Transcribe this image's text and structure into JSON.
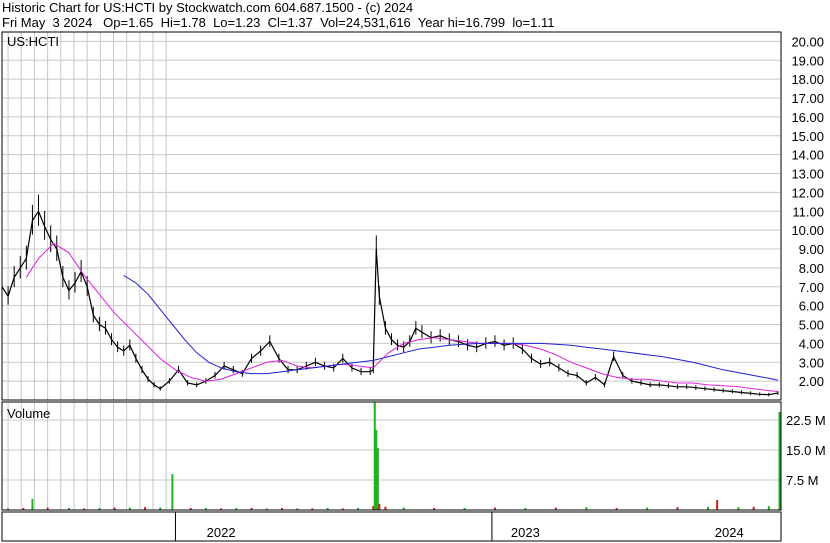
{
  "header": {
    "line1": "Historic Chart for US:HCTI by Stockwatch.com 604.687.1500 - (c) 2024",
    "date": "Fri May  3 2024",
    "op": "Op=1.65",
    "hi": "Hi=1.78",
    "lo": "Lo=1.23",
    "cl": "Cl=1.37",
    "vol": "Vol=24,531,616",
    "year_hi": "Year hi=16.799",
    "year_lo": "lo=1.11"
  },
  "colors": {
    "grid": "#c8c8c8",
    "price": "#000000",
    "ma_short": "#e020e0",
    "ma_long": "#2020d0",
    "volume_up": "#20b020",
    "volume_down": "#d02020",
    "frame": "#000000"
  },
  "chart_data": [
    {
      "type": "line",
      "title": "US:HCTI",
      "y_axis_side": "right",
      "ylim": [
        1.0,
        20.5
      ],
      "y_ticks": [
        "2.00",
        "3.00",
        "4.00",
        "5.00",
        "6.00",
        "7.00",
        "8.00",
        "9.00",
        "10.00",
        "11.00",
        "12.00",
        "13.00",
        "14.00",
        "15.00",
        "16.00",
        "17.00",
        "18.00",
        "19.00",
        "20.00"
      ],
      "x_range": [
        2021.78,
        2024.34
      ],
      "x_labels": [
        "2022",
        "2023",
        "2024"
      ],
      "series": [
        {
          "role": "price",
          "x": [
            2021.78,
            2021.8,
            2021.82,
            2021.84,
            2021.86,
            2021.88,
            2021.9,
            2021.92,
            2021.94,
            2021.96,
            2021.98,
            2022.0,
            2022.02,
            2022.04,
            2022.06,
            2022.08,
            2022.1,
            2022.12,
            2022.14,
            2022.16,
            2022.18,
            2022.2,
            2022.22,
            2022.24,
            2022.26,
            2022.28,
            2022.3,
            2022.33,
            2022.36,
            2022.39,
            2022.42,
            2022.45,
            2022.48,
            2022.51,
            2022.54,
            2022.57,
            2022.6,
            2022.63,
            2022.66,
            2022.69,
            2022.72,
            2022.75,
            2022.78,
            2022.81,
            2022.84,
            2022.87,
            2022.9,
            2022.93,
            2022.96,
            2022.99,
            2023.0,
            2023.01,
            2023.02,
            2023.04,
            2023.06,
            2023.08,
            2023.1,
            2023.12,
            2023.14,
            2023.16,
            2023.19,
            2023.22,
            2023.25,
            2023.28,
            2023.31,
            2023.34,
            2023.37,
            2023.4,
            2023.43,
            2023.46,
            2023.49,
            2023.52,
            2023.55,
            2023.58,
            2023.61,
            2023.64,
            2023.67,
            2023.7,
            2023.73,
            2023.76,
            2023.79,
            2023.82,
            2023.85,
            2023.88,
            2023.91,
            2023.94,
            2023.97,
            2024.0,
            2024.03,
            2024.06,
            2024.09,
            2024.12,
            2024.15,
            2024.18,
            2024.21,
            2024.24,
            2024.27,
            2024.3,
            2024.33
          ],
          "values": [
            7.0,
            6.5,
            7.5,
            8.0,
            8.5,
            10.5,
            11.0,
            10.2,
            9.5,
            9.0,
            7.5,
            6.8,
            7.2,
            7.8,
            7.0,
            5.5,
            5.0,
            4.8,
            4.2,
            3.8,
            3.6,
            3.9,
            3.2,
            2.6,
            2.1,
            1.8,
            1.6,
            2.0,
            2.6,
            1.9,
            1.8,
            2.0,
            2.3,
            2.8,
            2.6,
            2.4,
            3.2,
            3.6,
            4.1,
            3.2,
            2.6,
            2.6,
            2.8,
            3.0,
            2.8,
            2.7,
            3.2,
            2.7,
            2.5,
            2.5,
            2.6,
            9.0,
            6.5,
            4.8,
            4.2,
            3.9,
            3.8,
            4.1,
            4.8,
            4.6,
            4.3,
            4.4,
            4.2,
            4.1,
            3.9,
            3.8,
            4.0,
            4.1,
            3.9,
            4.0,
            3.7,
            3.2,
            2.9,
            3.0,
            2.7,
            2.4,
            2.3,
            1.9,
            2.2,
            1.8,
            3.3,
            2.3,
            2.0,
            1.9,
            1.8,
            1.8,
            1.75,
            1.7,
            1.7,
            1.65,
            1.6,
            1.55,
            1.5,
            1.45,
            1.4,
            1.35,
            1.3,
            1.28,
            1.37
          ]
        },
        {
          "role": "ma_short",
          "x": [
            2021.86,
            2021.9,
            2021.95,
            2022.0,
            2022.05,
            2022.1,
            2022.15,
            2022.2,
            2022.25,
            2022.3,
            2022.35,
            2022.4,
            2022.45,
            2022.5,
            2022.55,
            2022.6,
            2022.65,
            2022.7,
            2022.75,
            2022.8,
            2022.85,
            2022.9,
            2022.95,
            2023.0,
            2023.05,
            2023.1,
            2023.15,
            2023.2,
            2023.25,
            2023.3,
            2023.35,
            2023.4,
            2023.45,
            2023.5,
            2023.55,
            2023.6,
            2023.65,
            2023.7,
            2023.75,
            2023.8,
            2023.85,
            2023.9,
            2023.95,
            2024.0,
            2024.05,
            2024.1,
            2024.15,
            2024.2,
            2024.25,
            2024.3,
            2024.33
          ],
          "values": [
            7.5,
            8.5,
            9.3,
            8.8,
            7.6,
            6.6,
            5.6,
            4.8,
            4.0,
            3.2,
            2.6,
            2.2,
            2.0,
            2.1,
            2.4,
            2.7,
            3.0,
            3.1,
            2.8,
            2.7,
            2.8,
            2.9,
            2.8,
            2.7,
            3.5,
            4.0,
            4.2,
            4.3,
            4.2,
            4.1,
            4.0,
            4.0,
            4.0,
            3.9,
            3.7,
            3.4,
            3.0,
            2.7,
            2.4,
            2.2,
            2.1,
            2.1,
            2.0,
            1.9,
            1.9,
            1.8,
            1.75,
            1.7,
            1.6,
            1.5,
            1.45
          ]
        },
        {
          "role": "ma_long",
          "x": [
            2022.18,
            2022.22,
            2022.26,
            2022.3,
            2022.34,
            2022.38,
            2022.42,
            2022.46,
            2022.5,
            2022.55,
            2022.6,
            2022.65,
            2022.7,
            2022.75,
            2022.8,
            2022.85,
            2022.9,
            2022.95,
            2023.0,
            2023.05,
            2023.1,
            2023.15,
            2023.2,
            2023.25,
            2023.3,
            2023.35,
            2023.4,
            2023.45,
            2023.5,
            2023.55,
            2023.6,
            2023.65,
            2023.7,
            2023.75,
            2023.8,
            2023.85,
            2023.9,
            2023.95,
            2024.0,
            2024.05,
            2024.1,
            2024.15,
            2024.2,
            2024.25,
            2024.3,
            2024.33
          ],
          "values": [
            7.6,
            7.2,
            6.6,
            5.8,
            5.0,
            4.2,
            3.5,
            3.0,
            2.7,
            2.5,
            2.4,
            2.4,
            2.5,
            2.6,
            2.7,
            2.8,
            2.9,
            3.0,
            3.1,
            3.3,
            3.5,
            3.7,
            3.8,
            3.9,
            3.95,
            4.0,
            4.0,
            4.0,
            4.0,
            4.0,
            3.95,
            3.9,
            3.8,
            3.7,
            3.6,
            3.5,
            3.4,
            3.3,
            3.15,
            3.0,
            2.8,
            2.6,
            2.45,
            2.3,
            2.15,
            2.05
          ]
        }
      ]
    },
    {
      "type": "bar",
      "title": "Volume",
      "y_axis_side": "right",
      "ylim": [
        0,
        27.0
      ],
      "y_unit": "M",
      "y_ticks": [
        "7.5 M",
        "15.0 M",
        "22.5 M"
      ],
      "series": [
        {
          "name": "volume",
          "x": [
            2021.8,
            2021.85,
            2021.88,
            2021.93,
            2022.0,
            2022.05,
            2022.1,
            2022.15,
            2022.2,
            2022.25,
            2022.3,
            2022.34,
            2022.4,
            2022.45,
            2022.5,
            2022.55,
            2022.6,
            2022.65,
            2022.7,
            2022.75,
            2022.8,
            2022.85,
            2022.9,
            2022.95,
            2023.0,
            2023.005,
            2023.01,
            2023.015,
            2023.02,
            2023.04,
            2023.1,
            2023.2,
            2023.3,
            2023.4,
            2023.5,
            2023.6,
            2023.7,
            2023.8,
            2023.9,
            2024.0,
            2024.1,
            2024.13,
            2024.2,
            2024.25,
            2024.3,
            2024.335
          ],
          "values": [
            0.4,
            0.5,
            2.8,
            0.6,
            0.5,
            0.4,
            0.5,
            0.6,
            0.6,
            0.7,
            0.6,
            9.0,
            0.5,
            0.5,
            0.4,
            0.5,
            0.5,
            0.4,
            0.5,
            0.4,
            0.4,
            0.5,
            0.4,
            0.5,
            1.0,
            32.0,
            20.0,
            15.5,
            1.5,
            0.8,
            0.6,
            0.5,
            0.5,
            0.6,
            0.5,
            0.6,
            0.7,
            0.5,
            0.6,
            0.7,
            0.8,
            2.5,
            0.7,
            0.8,
            1.0,
            24.5
          ],
          "down": [
            false,
            true,
            false,
            true,
            false,
            true,
            false,
            true,
            false,
            true,
            false,
            false,
            true,
            false,
            true,
            false,
            true,
            false,
            true,
            false,
            true,
            false,
            true,
            false,
            true,
            false,
            false,
            false,
            true,
            true,
            false,
            true,
            false,
            true,
            false,
            true,
            false,
            true,
            false,
            true,
            false,
            true,
            false,
            true,
            false,
            false
          ]
        }
      ]
    }
  ]
}
